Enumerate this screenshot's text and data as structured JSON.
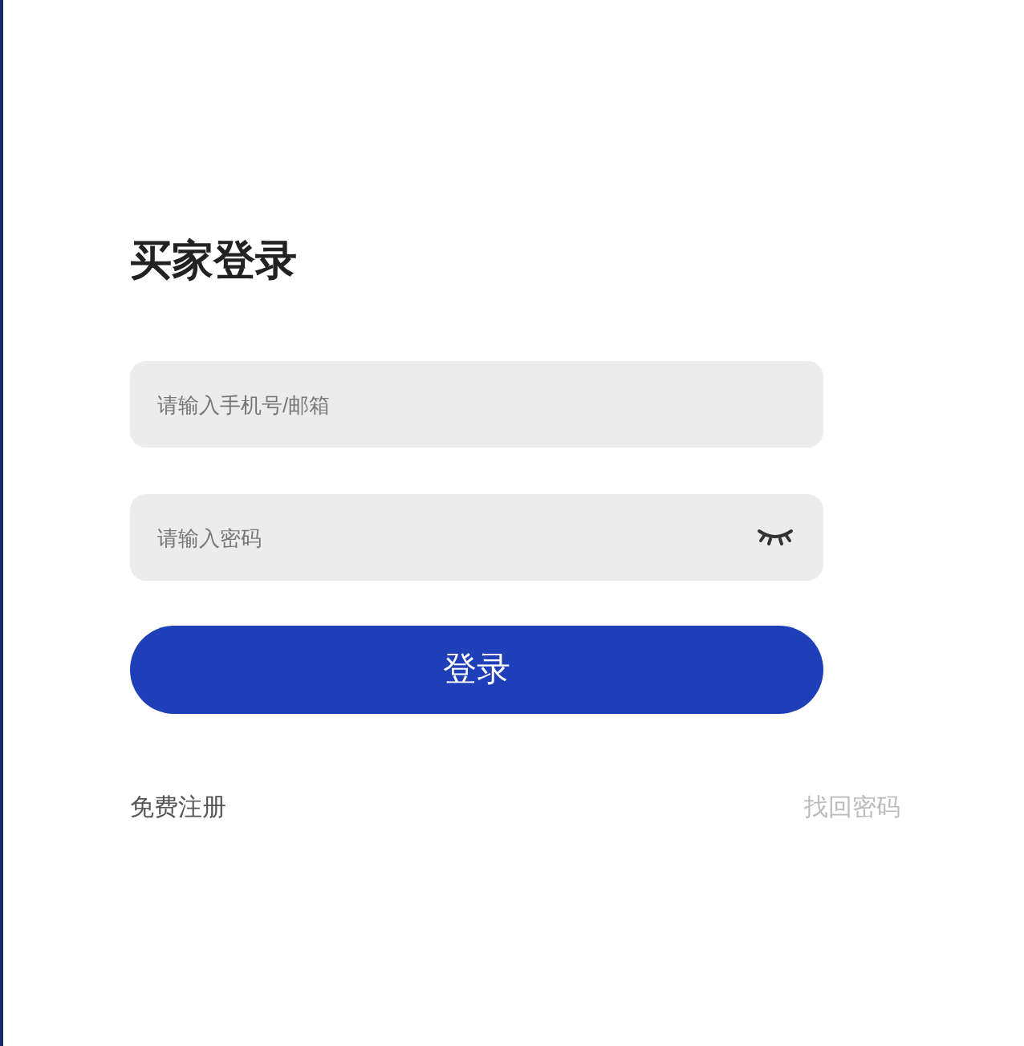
{
  "title": "买家登录",
  "fields": [
    {
      "kind": "text",
      "placeholder": "请输入手机号/邮箱"
    },
    {
      "kind": "password",
      "placeholder": "请输入密码",
      "password_visible": false
    }
  ],
  "submit": "登录",
  "links": [
    {
      "label": "免费注册",
      "muted": false
    },
    {
      "label": "找回密码",
      "muted": true
    }
  ]
}
